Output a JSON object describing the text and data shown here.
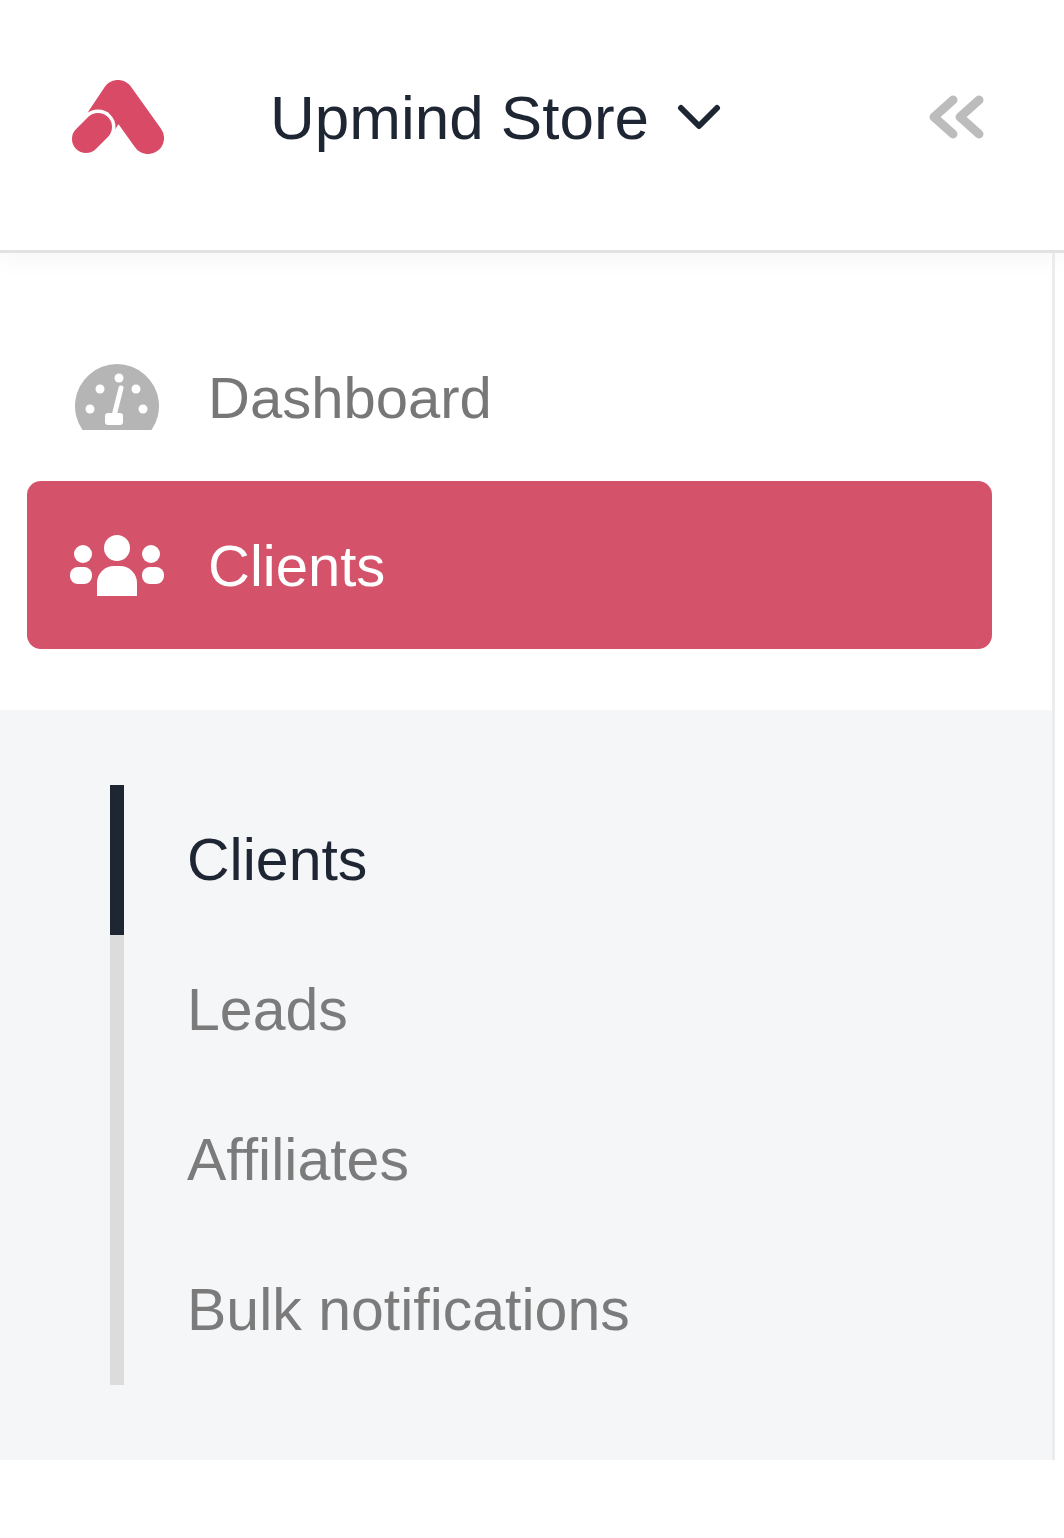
{
  "header": {
    "store_name": "Upmind Store"
  },
  "nav": [
    {
      "label": "Dashboard",
      "selected": false
    },
    {
      "label": "Clients",
      "selected": true,
      "children": [
        {
          "label": "Clients",
          "selected": true
        },
        {
          "label": "Leads",
          "selected": false
        },
        {
          "label": "Affiliates",
          "selected": false
        },
        {
          "label": "Bulk notifications",
          "selected": false
        }
      ]
    }
  ]
}
